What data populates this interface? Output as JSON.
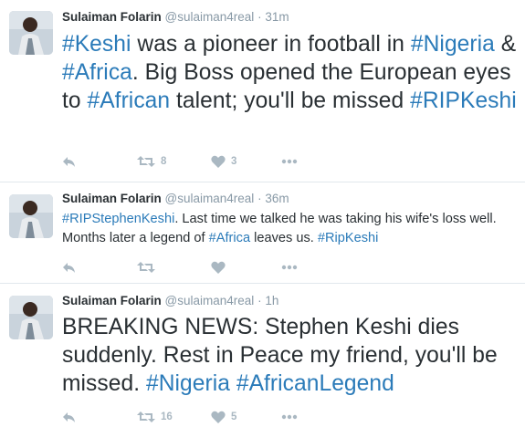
{
  "tweets": [
    {
      "name": "Sulaiman Folarin",
      "handle": "@sulaiman4real",
      "dot": "·",
      "time": "31m",
      "text": [
        {
          "t": "#Keshi",
          "tag": true
        },
        {
          "t": " was a pioneer in football in ",
          "tag": false
        },
        {
          "t": "#Nigeria",
          "tag": true
        },
        {
          "t": " & ",
          "tag": false
        },
        {
          "t": "#Africa",
          "tag": true
        },
        {
          "t": ". Big Boss opened the European eyes to ",
          "tag": false
        },
        {
          "t": "#African",
          "tag": true
        },
        {
          "t": " talent; you'll be missed ",
          "tag": false
        },
        {
          "t": "#RIPKeshi",
          "tag": true
        }
      ],
      "retweets": "8",
      "likes": "3"
    },
    {
      "name": "Sulaiman Folarin",
      "handle": "@sulaiman4real",
      "dot": "·",
      "time": "36m",
      "text": [
        {
          "t": "#RIPStephenKeshi",
          "tag": true
        },
        {
          "t": ". Last time we talked he was taking his wife's loss well. Months later a legend of ",
          "tag": false
        },
        {
          "t": "#Africa",
          "tag": true
        },
        {
          "t": " leaves us. ",
          "tag": false
        },
        {
          "t": "#RipKeshi",
          "tag": true
        }
      ],
      "retweets": "",
      "likes": ""
    },
    {
      "name": "Sulaiman Folarin",
      "handle": "@sulaiman4real",
      "dot": "·",
      "time": "1h",
      "text": [
        {
          "t": "BREAKING NEWS: Stephen Keshi dies suddenly. Rest in Peace my friend, you'll be missed. ",
          "tag": false
        },
        {
          "t": "#Nigeria",
          "tag": true
        },
        {
          "t": " ",
          "tag": false
        },
        {
          "t": "#AfricanLegend",
          "tag": true
        }
      ],
      "retweets": "16",
      "likes": "5"
    }
  ],
  "colors": {
    "link": "#2b7bb9",
    "meta": "#8899a6",
    "icon": "#aab8c2",
    "text": "#292f33",
    "divider": "#e1e8ed"
  },
  "icons": [
    "reply-icon",
    "retweet-icon",
    "like-icon",
    "more-icon"
  ]
}
